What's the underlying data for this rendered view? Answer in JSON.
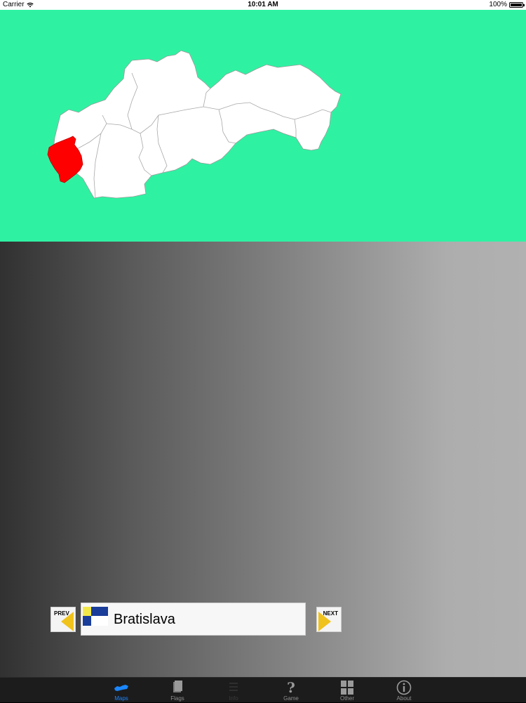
{
  "status_bar": {
    "carrier": "Carrier",
    "time": "10:01 AM",
    "battery": "100%"
  },
  "map": {
    "country": "Slovakia",
    "background_color": "#2ef2a2",
    "region_fill": "#ffffff",
    "highlight_color": "#ff0000",
    "highlighted_region": "Bratislava"
  },
  "navigator": {
    "prev_label": "PREV",
    "next_label": "NEXT",
    "region_name": "Bratislava",
    "arrow_color": "#f0c21c"
  },
  "tab_bar": {
    "tabs": [
      {
        "label": "Maps",
        "icon": "map-icon",
        "state": "active"
      },
      {
        "label": "Flags",
        "icon": "flag-book-icon",
        "state": "normal"
      },
      {
        "label": "Info",
        "icon": "info-list-icon",
        "state": "disabled"
      },
      {
        "label": "Game",
        "icon": "question-mark-icon",
        "state": "normal"
      },
      {
        "label": "Other",
        "icon": "grid-icon",
        "state": "normal"
      },
      {
        "label": "About",
        "icon": "info-circle-icon",
        "state": "normal"
      }
    ],
    "active_color": "#1a86ff"
  }
}
